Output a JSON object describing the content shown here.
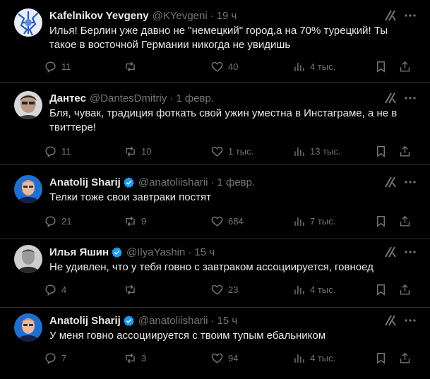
{
  "tweets": [
    {
      "name": "Kafelnikov Yevgeny",
      "verified": false,
      "handle": "@KYevgeni",
      "time": "19 ч",
      "text": "Илья! Берлин уже давно не \"немецкий\" город,а на 70% турецкий! Ты такое в восточной Германии никогда не увидишь",
      "replies": "11",
      "reposts": "",
      "likes": "40",
      "views": "4 тыс."
    },
    {
      "name": "Дантес",
      "verified": false,
      "handle": "@DantesDmitriy",
      "time": "1 февр.",
      "text": "Бля, чувак, традиция фоткать свой ужин уместна в Инстаграме, а не в твиттере!",
      "replies": "11",
      "reposts": "10",
      "likes": "1 тыс.",
      "views": "13 тыс."
    },
    {
      "name": "Anatolij Sharij",
      "verified": true,
      "handle": "@anatoliisharii",
      "time": "1 февр.",
      "text": "Телки тоже свои завтраки постят",
      "replies": "21",
      "reposts": "9",
      "likes": "684",
      "views": "7 тыс."
    },
    {
      "name": "Илья Яшин",
      "verified": true,
      "handle": "@IlyaYashin",
      "time": "15 ч",
      "text": "Не удивлен, что у тебя говно с завтраком ассоциируется, говноед",
      "replies": "4",
      "reposts": "",
      "likes": "23",
      "views": "4 тыс."
    },
    {
      "name": "Anatolij Sharij",
      "verified": true,
      "handle": "@anatoliisharii",
      "time": "15 ч",
      "text": "У меня говно ассоциируется с твоим тупым ебальником",
      "replies": "7",
      "reposts": "3",
      "likes": "94",
      "views": "4 тыс."
    }
  ],
  "colors": {
    "background": "#000000",
    "text": "#e7e9ea",
    "muted": "#71767b",
    "divider": "#2f3336",
    "verified": "#1d9bf0"
  },
  "icons": [
    "reply-icon",
    "repost-icon",
    "like-icon",
    "views-icon",
    "bookmark-icon",
    "share-icon",
    "grok-icon",
    "more-icon",
    "verified-badge-icon"
  ]
}
